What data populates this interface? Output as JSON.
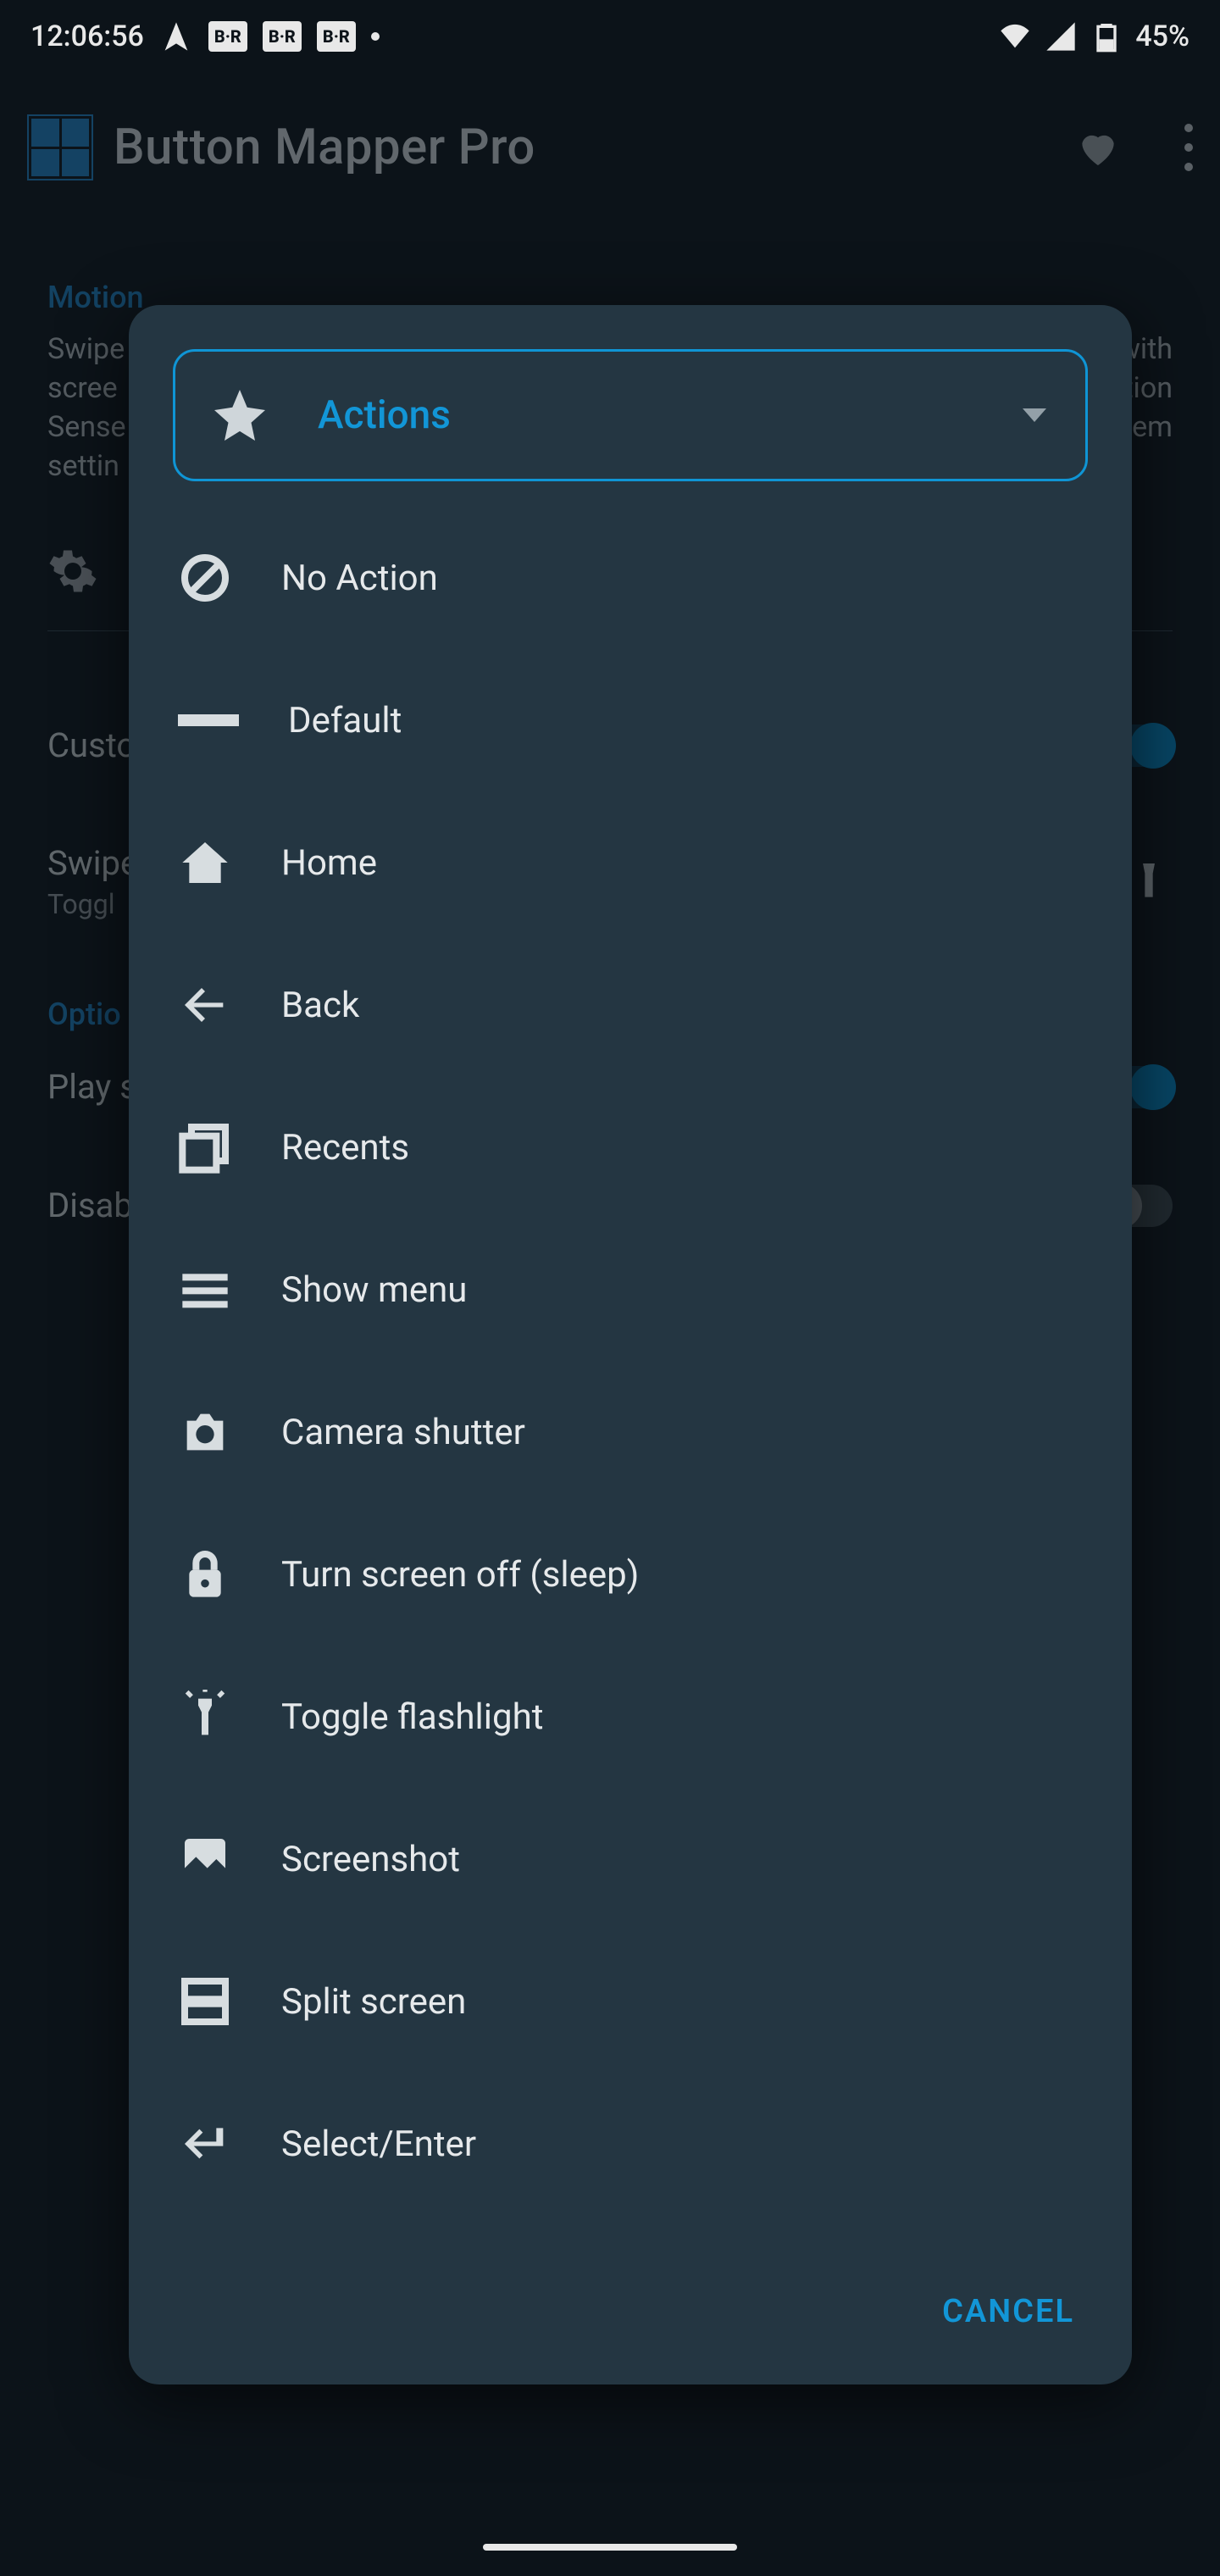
{
  "statusbar": {
    "time": "12:06:56",
    "chips": [
      "B·R",
      "B·R",
      "B·R"
    ],
    "battery_pct": "45%"
  },
  "appbar": {
    "title": "Button Mapper Pro"
  },
  "bg": {
    "section1": "Motion",
    "swipe_blurb_left": "Swipe\nscree\nSense\nsettin",
    "swipe_blurb_right": "s with\ntion\nem",
    "section2": "Custo",
    "swipe_row_label": "Swipe",
    "swipe_row_sub": "Toggl",
    "section3": "Optio",
    "play_row_label": "Play s",
    "disab_row_label": "Disab"
  },
  "dialog": {
    "dropdown_label": "Actions",
    "items": [
      {
        "id": "no-action",
        "label": "No Action"
      },
      {
        "id": "default",
        "label": "Default"
      },
      {
        "id": "home",
        "label": "Home"
      },
      {
        "id": "back",
        "label": "Back"
      },
      {
        "id": "recents",
        "label": "Recents"
      },
      {
        "id": "show-menu",
        "label": "Show menu"
      },
      {
        "id": "camera-shutter",
        "label": "Camera shutter"
      },
      {
        "id": "turn-screen-off",
        "label": "Turn screen off (sleep)"
      },
      {
        "id": "toggle-flashlight",
        "label": "Toggle flashlight"
      },
      {
        "id": "screenshot",
        "label": "Screenshot"
      },
      {
        "id": "split-screen",
        "label": "Split screen"
      },
      {
        "id": "select-enter",
        "label": "Select/Enter"
      }
    ],
    "cancel": "CANCEL"
  }
}
